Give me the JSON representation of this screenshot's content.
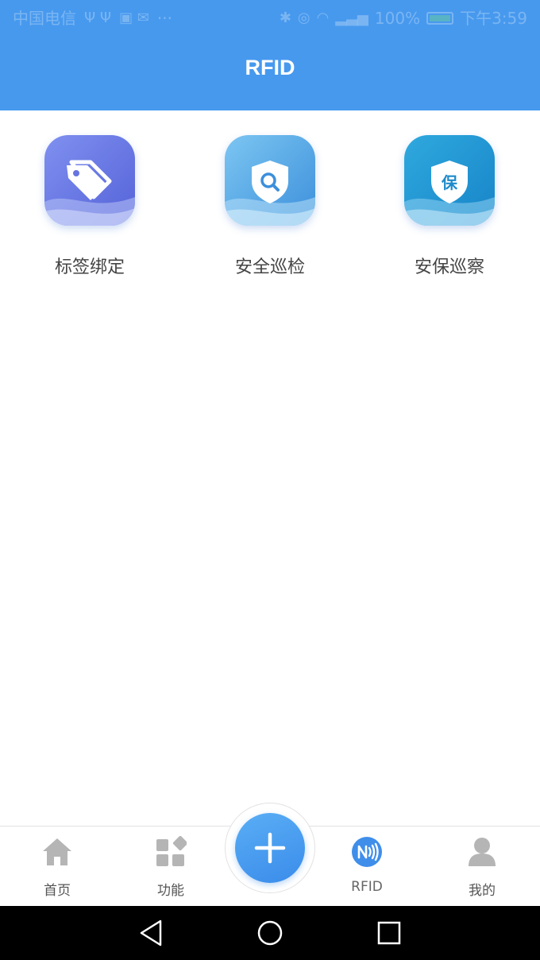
{
  "status_bar": {
    "carrier": "中国电信",
    "extras": "···",
    "battery": "100%",
    "time": "下午3:59"
  },
  "header": {
    "title": "RFID"
  },
  "apps": [
    {
      "label": "标签绑定",
      "icon": "tag-icon"
    },
    {
      "label": "安全巡检",
      "icon": "shield-search-icon"
    },
    {
      "label": "安保巡察",
      "icon": "shield-bao-icon",
      "icon_text": "保"
    }
  ],
  "bottom_nav": {
    "items": [
      {
        "label": "首页",
        "icon": "home-icon"
      },
      {
        "label": "功能",
        "icon": "grid-icon"
      },
      {
        "label": "RFID",
        "icon": "nfc-icon",
        "active": true
      },
      {
        "label": "我的",
        "icon": "user-icon"
      }
    ],
    "fab_icon": "plus-icon"
  },
  "colors": {
    "header": "#4799EE",
    "nav_inactive": "#B5B5B5",
    "nav_active": "#3F8EEA"
  }
}
